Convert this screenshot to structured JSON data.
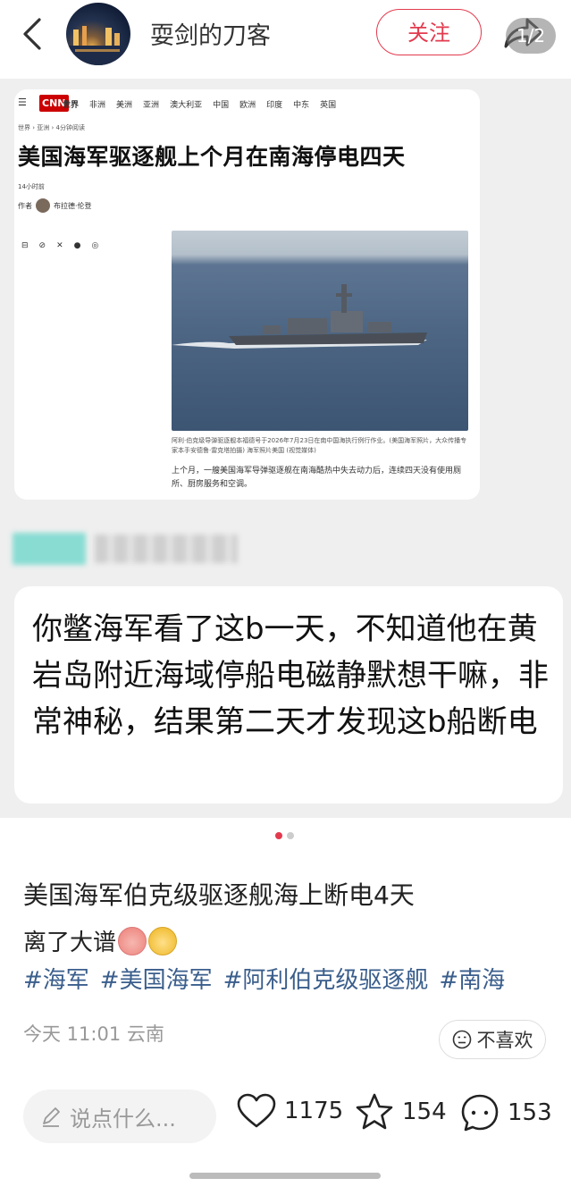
{
  "header": {
    "author": "耍剑的刀客",
    "follow_label": "关注"
  },
  "carousel": {
    "counter": "1/2",
    "slide1": {
      "logo": "CNN",
      "nav": [
        "世界",
        "非洲",
        "美洲",
        "亚洲",
        "澳大利亚",
        "中国",
        "欧洲",
        "印度",
        "中东",
        "英国"
      ],
      "breadcrumb": "世界 › 亚洲 › 4分钟阅读",
      "headline": "美国海军驱逐舰上个月在南海停电四天",
      "time_ago": "14小时前",
      "byline_prefix": "作者",
      "byline_name": "布拉德·伦登",
      "social_icons": [
        "⊟",
        "⊘",
        "✕",
        "●",
        "◎"
      ],
      "caption": "阿利·伯克级导弹驱逐舰本福德号于2026年7月23日在南中国海执行例行作业。(美国海军照片，大众传播专家本手安德鲁·雷克塔拍摄) 海军照片美国 (视觉媒体)",
      "body": "上个月，一艘美国海军导弹驱逐舰在南海酷热中失去动力后，连续四天没有使用厕所、厨房服务和空调。"
    },
    "slide_text": "你鳖海军看了这b一天，不知道他在黄岩岛附近海域停船电磁静默想干嘛，非常神秘，结果第二天才发现这b船断电"
  },
  "post": {
    "title": "美国海军伯克级驱逐舰海上断电4天",
    "body": "离了大谱",
    "tags": [
      "#海军",
      "#美国海军",
      "#阿利伯克级驱逐舰",
      "#南海"
    ],
    "meta": "今天 11:01 云南",
    "dislike_label": "不喜欢"
  },
  "bottom_bar": {
    "comment_placeholder": "说点什么...",
    "likes": "1175",
    "favorites": "154",
    "comments": "153"
  },
  "colors": {
    "accent": "#e33a4e",
    "tag": "#3a5e8c"
  }
}
